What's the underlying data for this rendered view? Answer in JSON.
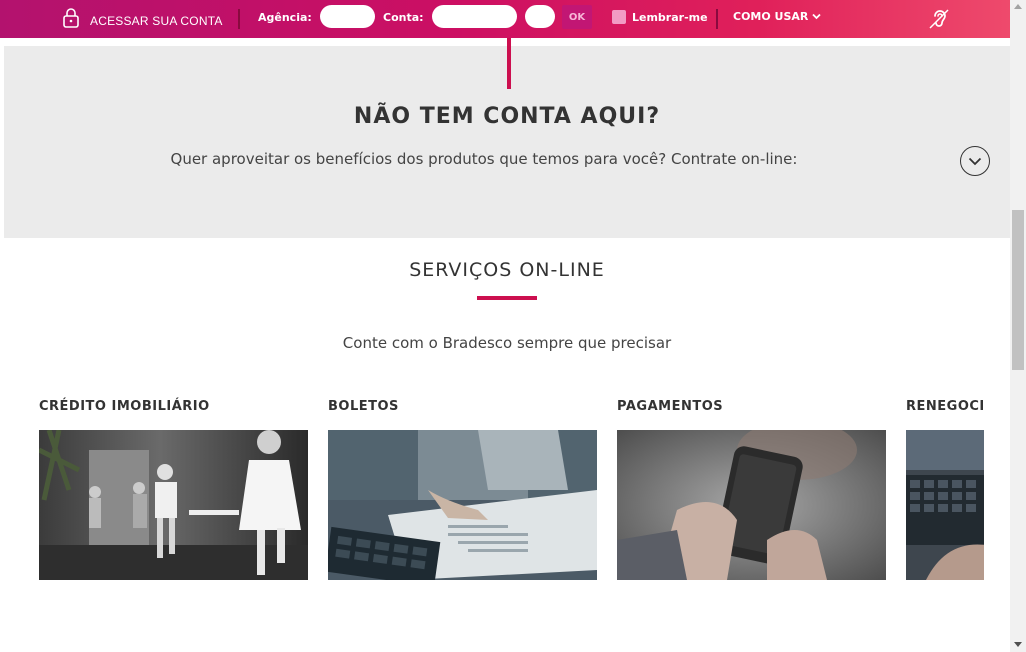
{
  "topbar": {
    "login_label": "ACESSAR SUA CONTA",
    "agency_label": "Agência:",
    "account_label": "Conta:",
    "ok_label": "OK",
    "remember_label": "Lembrar-me",
    "how_to_label": "COMO USAR"
  },
  "no_account": {
    "title": "NÃO TEM CONTA AQUI?",
    "subtitle": "Quer aproveitar os benefícios dos produtos que temos para você? Contrate on-line:"
  },
  "services": {
    "title": "SERVIÇOS ON-LINE",
    "subtitle": "Conte com o Bradesco sempre que precisar",
    "cards": [
      {
        "title": "CRÉDITO IMOBILIÁRIO"
      },
      {
        "title": "BOLETOS"
      },
      {
        "title": "PAGAMENTOS"
      },
      {
        "title": "RENEGOCIAÇÃO"
      }
    ]
  },
  "colors": {
    "brand": "#cc0f4f",
    "topbar_start": "#b3126e",
    "topbar_end": "#ee4a6c",
    "section_gray": "#ebebeb"
  },
  "icons": [
    "lock-icon",
    "chevron-down-icon",
    "hearing-accessibility-icon",
    "circle-chevron-down-icon"
  ]
}
